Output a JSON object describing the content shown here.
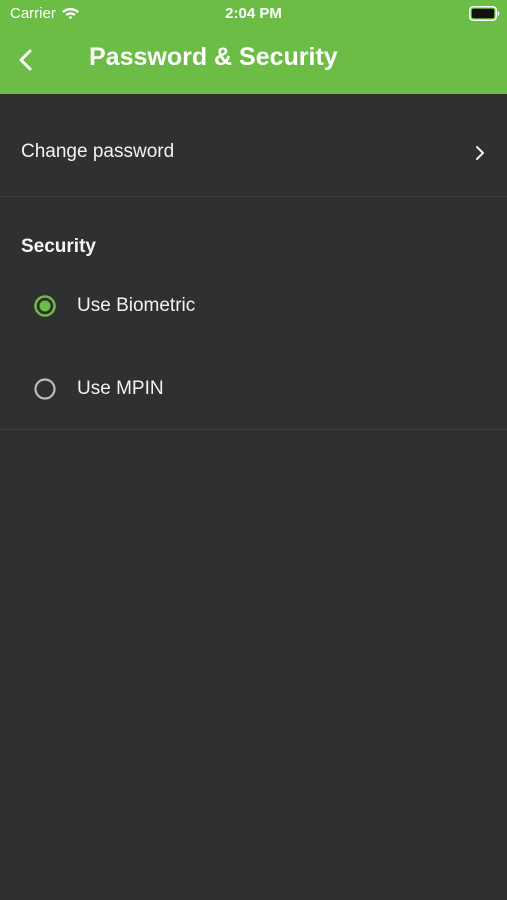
{
  "status_bar": {
    "carrier": "Carrier",
    "time": "2:04 PM",
    "wifi_icon": "wifi-icon",
    "battery_icon": "battery-icon"
  },
  "nav": {
    "title": "Password & Security",
    "back_icon": "chevron-left-icon"
  },
  "change_password": {
    "label": "Change password",
    "icon": "chevron-right-icon"
  },
  "security": {
    "title": "Security",
    "options": [
      {
        "label": "Use Biometric",
        "selected": true
      },
      {
        "label": "Use MPIN",
        "selected": false
      }
    ]
  },
  "colors": {
    "accent": "#6bbd45",
    "background": "#303030",
    "divider": "#3e3e3e",
    "text": "#f2f2f2",
    "radio_unselected": "#bdbdbd"
  }
}
